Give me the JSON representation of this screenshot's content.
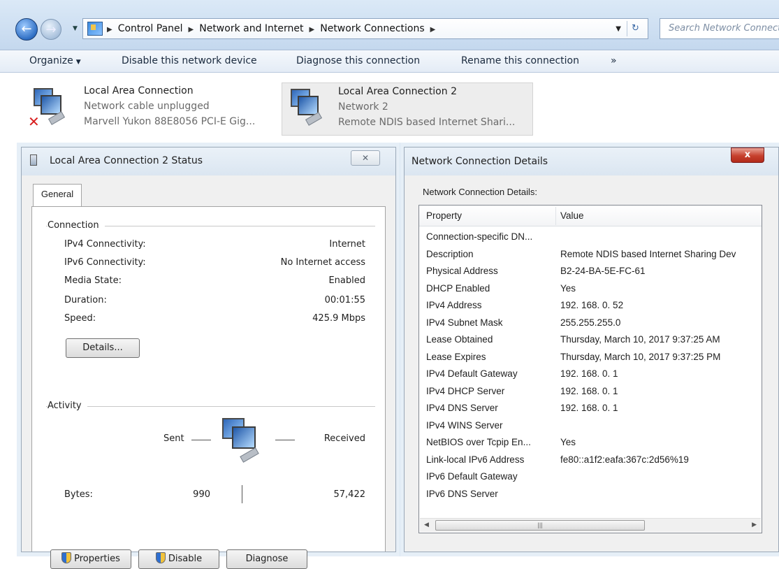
{
  "address": {
    "breadcrumbs": [
      "Control Panel",
      "Network and Internet",
      "Network Connections"
    ],
    "search_placeholder": "Search Network Connections"
  },
  "toolbar": {
    "organize": "Organize",
    "disable": "Disable this network device",
    "diagnose": "Diagnose this connection",
    "rename": "Rename this connection",
    "more": "»"
  },
  "connections": [
    {
      "name": "Local Area Connection",
      "status": "Network cable unplugged",
      "device": "Marvell Yukon 88E8056 PCI-E Gig..."
    },
    {
      "name": "Local Area Connection 2",
      "status": "Network  2",
      "device": "Remote NDIS based Internet Shari..."
    }
  ],
  "status_window": {
    "title": "Local Area Connection 2 Status",
    "close_glyph": "✕",
    "tab": "General",
    "connection_label": "Connection",
    "rows": [
      {
        "label": "IPv4 Connectivity:",
        "value": "Internet"
      },
      {
        "label": "IPv6 Connectivity:",
        "value": "No Internet access"
      },
      {
        "label": "Media State:",
        "value": "Enabled"
      },
      {
        "label": "Duration:",
        "value": "00:01:55"
      },
      {
        "label": "Speed:",
        "value": "425.9 Mbps"
      }
    ],
    "details_button": "Details...",
    "activity_label": "Activity",
    "sent_label": "Sent",
    "received_label": "Received",
    "bytes_label": "Bytes:",
    "bytes_sent": "990",
    "bytes_received": "57,422",
    "properties_button": "Properties",
    "disable_button": "Disable",
    "diagnose_button": "Diagnose"
  },
  "details_window": {
    "title": "Network Connection Details",
    "close_glyph": "x",
    "caption": "Network Connection Details:",
    "col_property": "Property",
    "col_value": "Value",
    "rows": [
      {
        "property": "Connection-specific DN...",
        "value": ""
      },
      {
        "property": "Description",
        "value": "Remote NDIS based Internet Sharing Dev"
      },
      {
        "property": "Physical Address",
        "value": "B2-24-BA-5E-FC-61"
      },
      {
        "property": "DHCP Enabled",
        "value": "Yes"
      },
      {
        "property": "IPv4 Address",
        "value": "192. 168. 0. 52"
      },
      {
        "property": "IPv4 Subnet Mask",
        "value": "255.255.255.0"
      },
      {
        "property": "Lease Obtained",
        "value": "Thursday, March 10, 2017 9:37:25 AM"
      },
      {
        "property": "Lease Expires",
        "value": "Thursday, March 10, 2017 9:37:25 PM"
      },
      {
        "property": "IPv4 Default Gateway",
        "value": "192. 168. 0. 1"
      },
      {
        "property": "IPv4 DHCP Server",
        "value": "192. 168. 0. 1"
      },
      {
        "property": "IPv4 DNS Server",
        "value": "192. 168. 0. 1"
      },
      {
        "property": "IPv4 WINS Server",
        "value": ""
      },
      {
        "property": "NetBIOS over Tcpip En...",
        "value": "Yes"
      },
      {
        "property": "Link-local IPv6 Address",
        "value": "fe80::a1f2:eafa:367c:2d56%19"
      },
      {
        "property": "IPv6 Default Gateway",
        "value": ""
      },
      {
        "property": "IPv6 DNS Server",
        "value": ""
      }
    ]
  }
}
